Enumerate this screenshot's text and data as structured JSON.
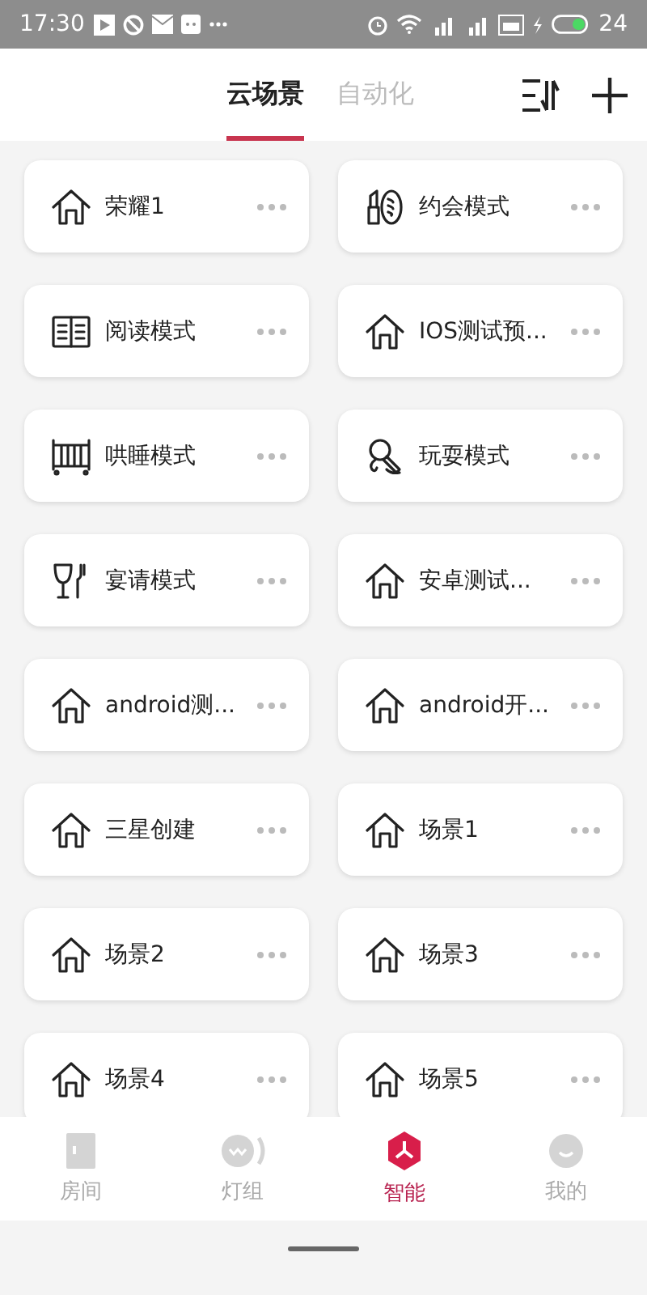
{
  "status_bar": {
    "time": "17:30",
    "battery": "24"
  },
  "tabs": [
    {
      "label": "云场景",
      "selected": true
    },
    {
      "label": "自动化",
      "selected": false
    }
  ],
  "scenes": [
    {
      "name": "荣耀1",
      "kind": "house"
    },
    {
      "name": "约会模式",
      "kind": "lipstick"
    },
    {
      "name": "阅读模式",
      "kind": "book"
    },
    {
      "name": "IOS测试预...",
      "kind": "house"
    },
    {
      "name": "哄睡模式",
      "kind": "crib"
    },
    {
      "name": "玩耍模式",
      "kind": "microphone"
    },
    {
      "name": "宴请模式",
      "kind": "dining"
    },
    {
      "name": "安卓测试...",
      "kind": "house"
    },
    {
      "name": "android测...",
      "kind": "house"
    },
    {
      "name": "android开...",
      "kind": "house"
    },
    {
      "name": "三星创建",
      "kind": "house"
    },
    {
      "name": "场景1",
      "kind": "house"
    },
    {
      "name": "场景2",
      "kind": "house"
    },
    {
      "name": "场景3",
      "kind": "house"
    },
    {
      "name": "场景4",
      "kind": "house"
    },
    {
      "name": "场景5",
      "kind": "house"
    }
  ],
  "bottom_nav": [
    {
      "label": "房间",
      "kind": "room",
      "selected": false
    },
    {
      "label": "灯组",
      "kind": "lights",
      "selected": false
    },
    {
      "label": "智能",
      "kind": "smart",
      "selected": true
    },
    {
      "label": "我的",
      "kind": "me",
      "selected": false
    }
  ]
}
